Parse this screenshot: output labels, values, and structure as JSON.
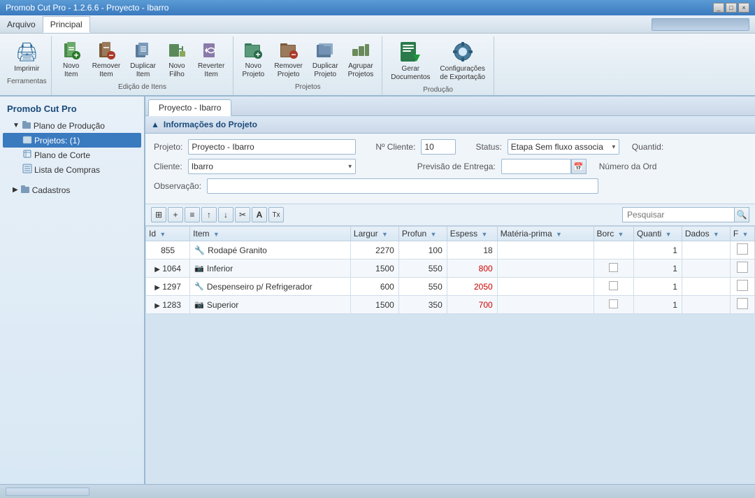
{
  "titleBar": {
    "title": "Promob Cut Pro - 1.2.6.6 - Proyecto - Ibarro",
    "controls": [
      "_",
      "□",
      "×"
    ]
  },
  "menuBar": {
    "items": [
      "Arquivo",
      "Principal"
    ],
    "activeItem": "Principal",
    "searchPlaceholder": ""
  },
  "ribbon": {
    "groups": [
      {
        "name": "Ferramentas",
        "items": [
          {
            "id": "print",
            "label": "Imprimir",
            "icon": "🖨",
            "large": true
          }
        ]
      },
      {
        "name": "Edição de Itens",
        "items": [
          {
            "id": "new-item",
            "label": "Novo\nItem",
            "icon": "📦"
          },
          {
            "id": "remove-item",
            "label": "Remover\nItem",
            "icon": "🗑"
          },
          {
            "id": "duplicate-item",
            "label": "Duplicar\nItem",
            "icon": "📋"
          },
          {
            "id": "new-child",
            "label": "Novo\nFilho",
            "icon": "📁"
          },
          {
            "id": "revert-item",
            "label": "Reverter\nItem",
            "icon": "↩"
          }
        ]
      },
      {
        "name": "Projetos",
        "items": [
          {
            "id": "new-project",
            "label": "Novo\nProjeto",
            "icon": "📄"
          },
          {
            "id": "remove-project",
            "label": "Remover\nProjeto",
            "icon": "🗑"
          },
          {
            "id": "duplicate-project",
            "label": "Duplicar\nProjeto",
            "icon": "📋"
          },
          {
            "id": "group-projects",
            "label": "Agrupar\nProjetos",
            "icon": "📦"
          }
        ]
      },
      {
        "name": "Produção",
        "items": [
          {
            "id": "gerar-docs",
            "label": "Gerar\nDocumentos",
            "icon": "📊",
            "large": true
          },
          {
            "id": "config-export",
            "label": "Configurações\nde Exportação",
            "icon": "⚙",
            "large": true
          }
        ]
      }
    ]
  },
  "sidebar": {
    "title": "Promob Cut Pro",
    "tree": [
      {
        "id": "plano-producao",
        "label": "Plano de Produção",
        "level": 1,
        "type": "folder",
        "expanded": true
      },
      {
        "id": "projetos",
        "label": "Projetos: (1)",
        "level": 2,
        "type": "project",
        "selected": true
      },
      {
        "id": "plano-corte",
        "label": "Plano de Corte",
        "level": 2,
        "type": "cut"
      },
      {
        "id": "lista-compras",
        "label": "Lista de Compras",
        "level": 2,
        "type": "list"
      },
      {
        "id": "cadastros",
        "label": "Cadastros",
        "level": 1,
        "type": "folder",
        "expanded": false
      }
    ]
  },
  "content": {
    "tabLabel": "Proyecto - Ibarro",
    "sectionTitle": "Informações do Projeto",
    "form": {
      "projetoLabel": "Projeto:",
      "projetoValue": "Proyecto - Ibarro",
      "clienteNumLabel": "Nº Cliente:",
      "clienteNumValue": "10",
      "statusLabel": "Status:",
      "statusValue": "Etapa Sem fluxo associa",
      "quantidadeLabel": "Quantid:",
      "clienteLabel": "Cliente:",
      "clienteValue": "Ibarro",
      "previsaoLabel": "Previsão de Entrega:",
      "previsaoValue": "",
      "numeroOrdLabel": "Número da Ord",
      "observacaoLabel": "Observação:",
      "observacaoValue": ""
    },
    "tableToolbar": {
      "buttons": [
        "⊞",
        "+",
        "≡",
        "↑",
        "↓",
        "✂",
        "A",
        "Tx"
      ],
      "searchPlaceholder": "Pesquisar"
    },
    "table": {
      "columns": [
        {
          "id": "id",
          "label": "Id"
        },
        {
          "id": "item",
          "label": "Item"
        },
        {
          "id": "largura",
          "label": "Largur"
        },
        {
          "id": "profundidade",
          "label": "Profun"
        },
        {
          "id": "espessura",
          "label": "Espess"
        },
        {
          "id": "materia-prima",
          "label": "Matéria-prima"
        },
        {
          "id": "bordo",
          "label": "Borc"
        },
        {
          "id": "quantidade",
          "label": "Quanti"
        },
        {
          "id": "dados",
          "label": "Dados"
        },
        {
          "id": "flag",
          "label": "F"
        }
      ],
      "rows": [
        {
          "id": "855",
          "expandable": false,
          "icon": "🔧",
          "item": "Rodapé Granito",
          "largura": "2270",
          "profundidade": "100",
          "espessura": "18",
          "espessuraRed": false,
          "materiaPrima": "",
          "bordo": "",
          "quantidade": "1",
          "dados": "",
          "flag": false
        },
        {
          "id": "1064",
          "expandable": true,
          "icon": "📷",
          "item": "Inferior",
          "largura": "1500",
          "profundidade": "550",
          "espessura": "800",
          "espessuraRed": true,
          "materiaPrima": "",
          "bordo": "□",
          "quantidade": "1",
          "dados": "",
          "flag": false
        },
        {
          "id": "1297",
          "expandable": true,
          "icon": "🔧",
          "item": "Despenseiro p/ Refrigerador",
          "largura": "600",
          "profundidade": "550",
          "espessura": "2050",
          "espessuraRed": true,
          "materiaPrima": "",
          "bordo": "□",
          "quantidade": "1",
          "dados": "",
          "flag": false
        },
        {
          "id": "1283",
          "expandable": true,
          "icon": "📷",
          "item": "Superior",
          "largura": "1500",
          "profundidade": "350",
          "espessura": "700",
          "espessuraRed": true,
          "materiaPrima": "",
          "bordo": "□",
          "quantidade": "1",
          "dados": "",
          "flag": false
        }
      ]
    }
  },
  "statusBar": {}
}
